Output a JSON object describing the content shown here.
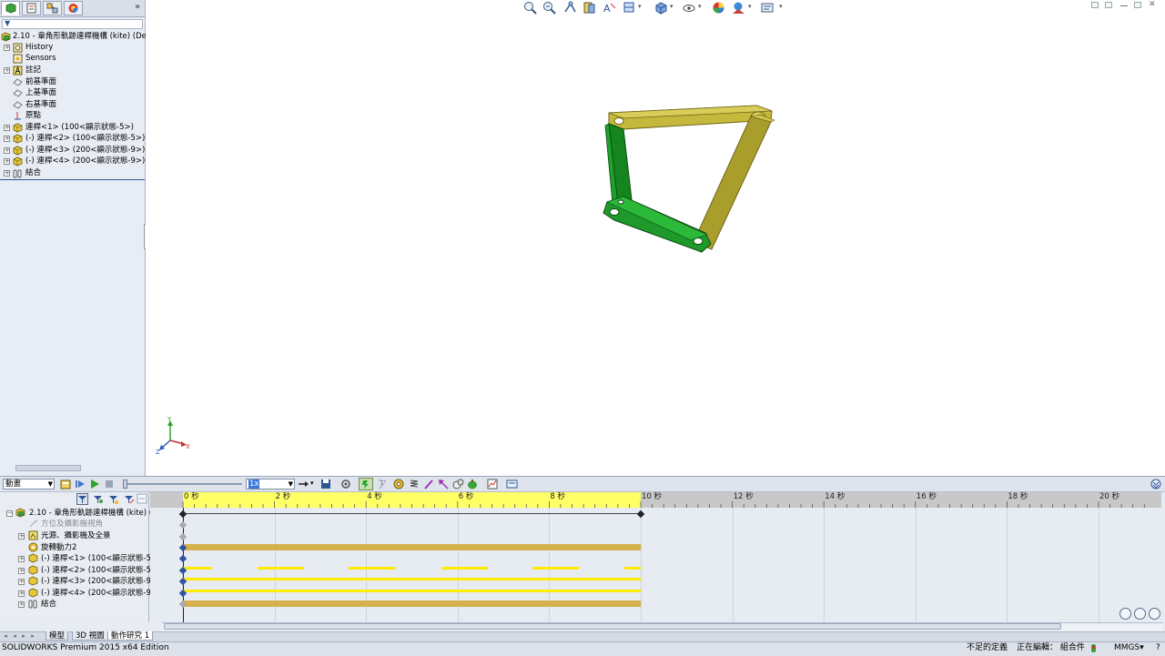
{
  "feature_manager": {
    "tabs": [
      "featuremanager-tab",
      "propertymanager-tab",
      "configurationmanager-tab",
      "displaymanager-tab"
    ],
    "expand_chevron": "»",
    "filter_icon": "▼",
    "items": [
      {
        "label": "2.10 - 章角形軌跡連桿機構 (kite)  (Def",
        "icon": "assembly-icon"
      },
      {
        "label": "History",
        "icon": "history-icon"
      },
      {
        "label": "Sensors",
        "icon": "sensors-icon"
      },
      {
        "label": "註記",
        "icon": "annotations-icon"
      },
      {
        "label": "前基準面",
        "icon": "plane-icon"
      },
      {
        "label": "上基準面",
        "icon": "plane-icon"
      },
      {
        "label": "右基準面",
        "icon": "plane-icon"
      },
      {
        "label": "原點",
        "icon": "origin-icon"
      },
      {
        "label": "連桿<1> (100<顯示狀態-5>)",
        "icon": "part-icon"
      },
      {
        "label": "(-) 連桿<2> (100<顯示狀態-5>)",
        "icon": "part-icon"
      },
      {
        "label": "(-) 連桿<3> (200<顯示狀態-9>)",
        "icon": "part-icon"
      },
      {
        "label": "(-) 連桿<4> (200<顯示狀態-9>)",
        "icon": "part-icon"
      },
      {
        "label": "結合",
        "icon": "mates-icon"
      }
    ]
  },
  "graphics": {
    "hud_icons": [
      "zoom-to-fit-icon",
      "zoom-to-area-icon",
      "previous-view-icon",
      "section-view-icon",
      "dynamic-annotation-icon",
      "view-orientation-icon",
      "display-style-icon",
      "hide-show-items-icon",
      "edit-appearance-icon",
      "apply-scene-icon",
      "view-settings-icon"
    ],
    "triad_labels": {
      "y": "Y",
      "x": "X",
      "z": "Z"
    },
    "colors": {
      "green_link": "#1e9a2a",
      "olive_link": "#b5a832"
    }
  },
  "motion_manager": {
    "study_type": "動畫",
    "speed_value": "1x",
    "ruler_labels": [
      "0 秒",
      "2 秒",
      "4 秒",
      "6 秒",
      "8 秒",
      "10 秒",
      "12 秒",
      "14 秒",
      "16 秒",
      "18 秒",
      "20 秒"
    ],
    "tree": [
      {
        "label": "2.10 - 章角形軌跡連桿機構 (kite)  (I",
        "icon": "assembly-icon",
        "grey": false
      },
      {
        "label": "方位及攝影機視角",
        "icon": "orientation-icon",
        "grey": true
      },
      {
        "label": "光源、攝影機及全景",
        "icon": "lights-icon",
        "grey": false
      },
      {
        "label": "旋轉動力2",
        "icon": "motor-icon",
        "grey": false
      },
      {
        "label": "(-) 連桿<1> (100<顯示狀態-5>",
        "icon": "part-icon",
        "grey": false
      },
      {
        "label": "(-) 連桿<2> (100<顯示狀態-5>",
        "icon": "part-icon",
        "grey": false
      },
      {
        "label": "(-) 連桿<3> (200<顯示狀態-9>",
        "icon": "part-icon",
        "grey": false
      },
      {
        "label": "(-) 連桿<4> (200<顯示狀態-9>",
        "icon": "part-icon",
        "grey": false
      },
      {
        "label": "結合",
        "icon": "mates-icon",
        "grey": false
      }
    ],
    "timeline_end_seconds": 10,
    "timeline_max_seconds": 21
  },
  "bottom_tabs": [
    "模型",
    "3D 視圖",
    "動作研究 1"
  ],
  "status_bar": {
    "product": "SOLIDWORKS Premium 2015 x64 Edition",
    "definition": "不足的定義",
    "editing": "正在編輯： 組合件",
    "units": "MMGS",
    "units_dropdown": "▾",
    "help": "?"
  }
}
